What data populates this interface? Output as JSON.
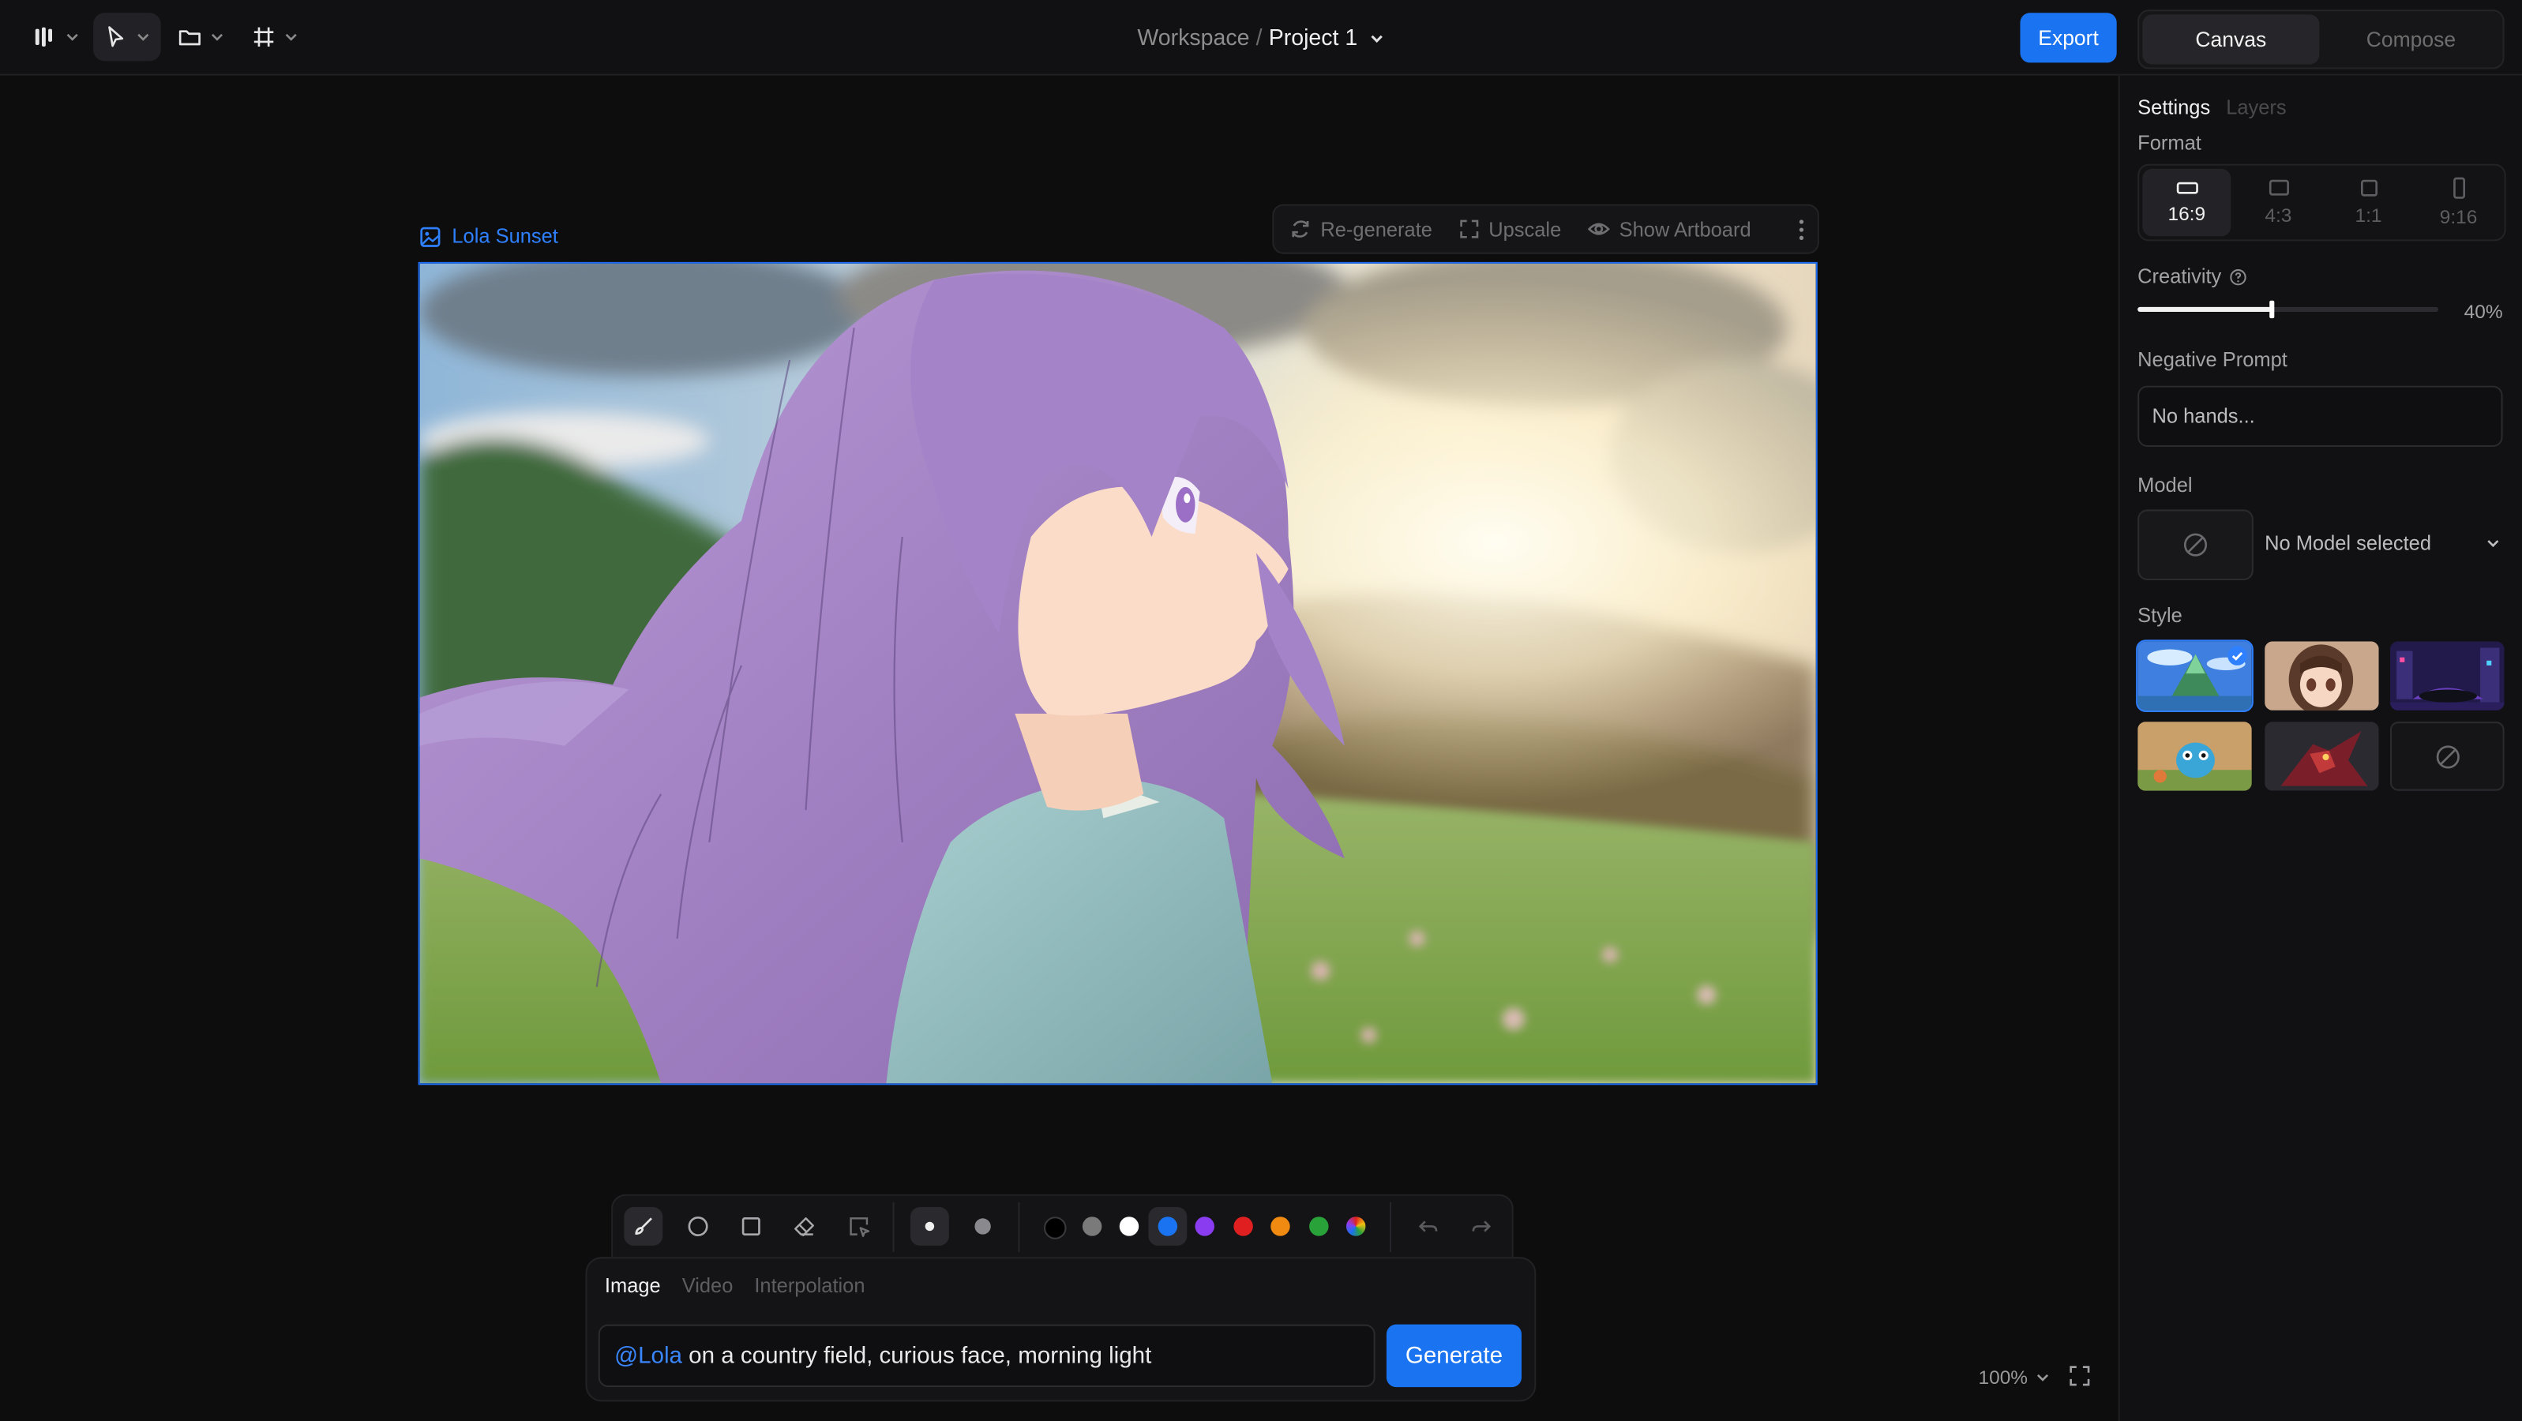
{
  "topbar": {
    "breadcrumb_workspace": "Workspace",
    "breadcrumb_separator": "/",
    "breadcrumb_project": "Project 1",
    "export_label": "Export",
    "mode_tabs": [
      "Canvas",
      "Compose"
    ],
    "active_mode": "Canvas"
  },
  "artboard": {
    "label": "Lola Sunset",
    "toolbar": {
      "regenerate": "Re-generate",
      "upscale": "Upscale",
      "show_artboard": "Show Artboard"
    }
  },
  "draw_toolbar": {
    "tools": [
      "brush-icon",
      "circle-icon",
      "square-icon",
      "eraser-icon",
      "select-icon"
    ],
    "active_tool": "brush-icon",
    "brush_sizes": [
      "small",
      "large"
    ],
    "colors": [
      "#000000",
      "#7a7a7a",
      "#ffffff",
      "#1a73f0",
      "#8a3df0",
      "#e02020",
      "#f08a10",
      "#2aa23a",
      "multicolor"
    ],
    "selected_color": "#1a73f0"
  },
  "prompt": {
    "tabs": [
      "Image",
      "Video",
      "Interpolation"
    ],
    "active_tab": "Image",
    "mention": "@Lola",
    "text": " on a country field, curious face, morning light",
    "generate_label": "Generate"
  },
  "view": {
    "zoom": "100%"
  },
  "settings_panel": {
    "tabs": [
      "Settings",
      "Layers"
    ],
    "active_tab": "Settings",
    "format_label": "Format",
    "formats": [
      "16:9",
      "4:3",
      "1:1",
      "9:16"
    ],
    "selected_format": "16:9",
    "creativity_label": "Creativity",
    "creativity_value": "40%",
    "creativity_fraction": 0.4,
    "negative_prompt_label": "Negative Prompt",
    "negative_prompt_placeholder": "No hands...",
    "model_label": "Model",
    "model_value": "No Model selected",
    "style_label": "Style",
    "styles": [
      "fantasy-landscape",
      "anime-girl",
      "cyberpunk-city",
      "3d-creature",
      "mecha",
      "none"
    ],
    "selected_style": "fantasy-landscape"
  },
  "colors": {
    "accent": "#1a73f0",
    "background": "#0d0d0e",
    "panel": "#111113"
  }
}
